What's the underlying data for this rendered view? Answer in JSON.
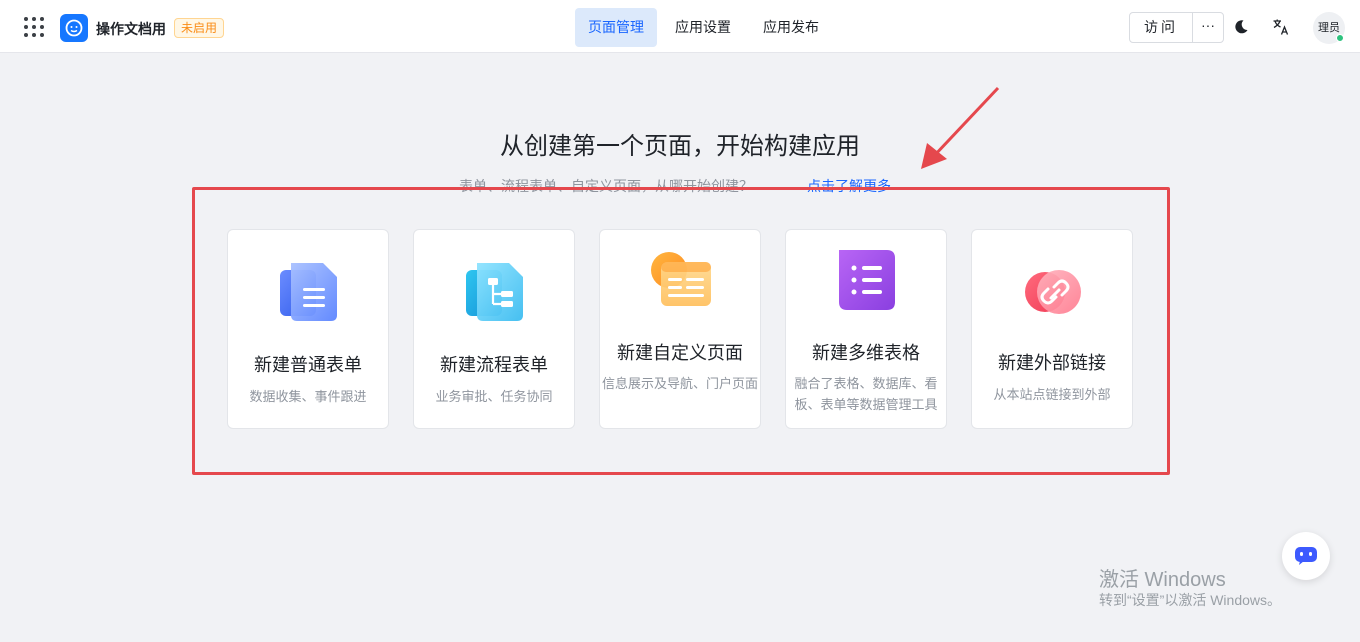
{
  "header": {
    "app_name": "操作文档用",
    "status_badge": "未启用",
    "tabs": [
      {
        "label": "页面管理",
        "active": true
      },
      {
        "label": "应用设置",
        "active": false
      },
      {
        "label": "应用发布",
        "active": false
      }
    ],
    "visit_label": "访问",
    "more_label": "···",
    "avatar_text": "理员"
  },
  "main": {
    "title": "从创建第一个页面，开始构建应用",
    "subtitle": "表单、流程表单、自定义页面，从哪开始创建？",
    "learn_more": "点击了解更多"
  },
  "cards": [
    {
      "title": "新建普通表单",
      "desc": "数据收集、事件跟进",
      "icon": "form-icon"
    },
    {
      "title": "新建流程表单",
      "desc": "业务审批、任务协同",
      "icon": "workflow-form-icon"
    },
    {
      "title": "新建自定义页面",
      "desc": "信息展示及导航、门户页面",
      "icon": "custom-page-icon"
    },
    {
      "title": "新建多维表格",
      "desc": "融合了表格、数据库、看板、表单等数据管理工具",
      "icon": "multi-table-icon"
    },
    {
      "title": "新建外部链接",
      "desc": "从本站点链接到外部",
      "icon": "link-icon"
    }
  ],
  "watermark": {
    "title": "激活 Windows",
    "subtitle": "转到“设置”以激活 Windows。"
  },
  "colors": {
    "primary": "#1a66ff",
    "highlight_box": "#e5484d",
    "badge_text": "#fa8c16"
  }
}
